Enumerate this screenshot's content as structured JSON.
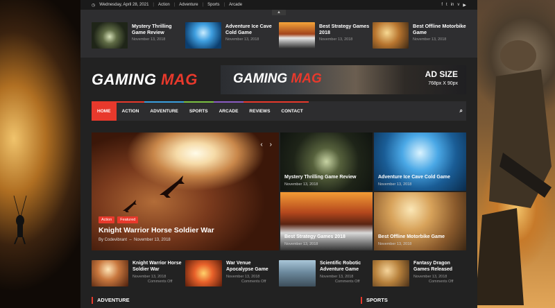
{
  "topbar": {
    "date": "Wednesday, April 28, 2021",
    "links": [
      "Action",
      "Adventure",
      "Sports",
      "Arcade"
    ],
    "social_icons": [
      "facebook-icon",
      "twitter-icon",
      "linkedin-icon",
      "vimeo-icon",
      "youtube-icon"
    ]
  },
  "ticker": [
    {
      "title": "Mystery Thrilling Game Review",
      "date": "November 13, 2018"
    },
    {
      "title": "Adventure Ice Cave Cold Game",
      "date": "November 13, 2018"
    },
    {
      "title": "Best Strategy Games 2018",
      "date": "November 13, 2018"
    },
    {
      "title": "Best Offline Motorbike Game",
      "date": "November 13, 2018"
    }
  ],
  "logo": {
    "white": "GAMING",
    "red": "MAG"
  },
  "ad": {
    "logo_white": "GAMING",
    "logo_red": "MAG",
    "size_label": "AD SIZE",
    "dimensions": "768px X 90px"
  },
  "nav": {
    "items": [
      "HOME",
      "ACTION",
      "ADVENTURE",
      "SPORTS",
      "ARCADE",
      "REVIEWS",
      "CONTACT"
    ],
    "bar_colors": [
      "#e8392c",
      "#e8392c",
      "#3aa0e0",
      "#7bc142",
      "#8b5cc4",
      "#e8392c",
      "#e8392c"
    ]
  },
  "hero": {
    "badges": [
      "Action",
      "Featured"
    ],
    "title": "Knight Warrior Horse Soldier War",
    "author": "By Codevibrant",
    "date": "November 13, 2018"
  },
  "grid": [
    {
      "title": "Mystery Thrilling Game Review",
      "date": "November 13, 2018"
    },
    {
      "title": "Adventure Ice Cave Cold Game",
      "date": "November 13, 2018"
    },
    {
      "title": "Best Strategy Games 2018",
      "date": "November 13, 2018"
    },
    {
      "title": "Best Offline Motorbike Game",
      "date": "November 13, 2018"
    }
  ],
  "row": [
    {
      "title": "Knight Warrior Horse Soldier War",
      "date": "November 13, 2018",
      "comments": "Comments Off"
    },
    {
      "title": "War Venue Apocalypse Game",
      "date": "November 13, 2018",
      "comments": "Comments Off"
    },
    {
      "title": "Scientific Robotic Adventure Game",
      "date": "November 13, 2018",
      "comments": "Comments Off"
    },
    {
      "title": "Fantasy Dragon Games Released",
      "date": "November 13, 2018",
      "comments": "Comments Off"
    }
  ],
  "sections": {
    "adventure": "ADVENTURE",
    "sports": "SPORTS"
  },
  "colors": {
    "accent": "#e8392c",
    "nav_bg": "#2d2d2f",
    "page_bg": "#222222"
  }
}
